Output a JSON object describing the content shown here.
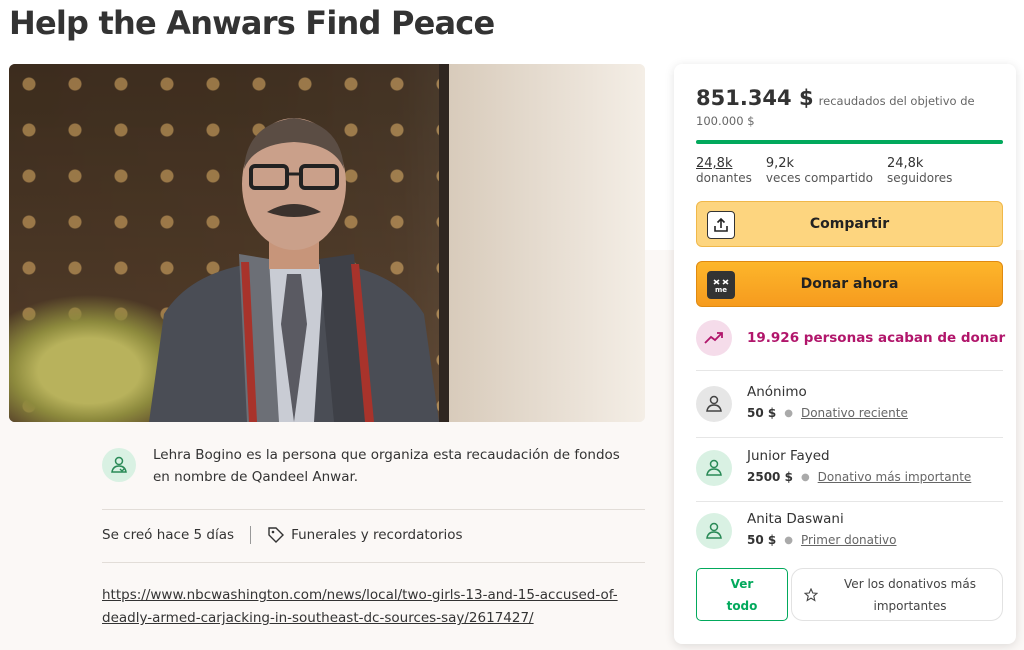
{
  "page": {
    "title": "Help the Anwars Find Peace"
  },
  "organizer": {
    "text": "Lehra Bogino es la persona que organiza esta recaudación de fondos en nombre de Qandeel Anwar.",
    "created": "Se creó hace 5 días",
    "category": "Funerales y recordatorios",
    "link": "https://www.nbcwashington.com/news/local/two-girls-13-and-15-accused-of-deadly-armed-carjacking-in-southeast-dc-sources-say/2617427/"
  },
  "panel": {
    "raised": "851.344 $",
    "goal_text": "recaudados del objetivo de 100.000 $",
    "progress_fraction": 1.0,
    "progress_color": "#02a95c",
    "stats": [
      {
        "num": "24,8k",
        "label": "donantes"
      },
      {
        "num": "9,2k",
        "label": "veces compartido"
      },
      {
        "num": "24,8k",
        "label": "seguidores"
      }
    ],
    "share_label": "Compartir",
    "donate_label": "Donar ahora",
    "recent_text": "19.926 personas acaban de donar",
    "donors": [
      {
        "name": "Anónimo",
        "amount": "50 $",
        "tag": "Donativo reciente"
      },
      {
        "name": "Junior Fayed",
        "amount": "2500 $",
        "tag": "Donativo más importante"
      },
      {
        "name": "Anita Daswani",
        "amount": "50 $",
        "tag": "Primer donativo"
      }
    ],
    "see_all_label": "Ver todo",
    "see_top_label": "Ver los donativos más importantes"
  },
  "icons": {
    "share": "share-upload-icon",
    "donate": "gofundme-me-icon",
    "trend": "trending-up-icon",
    "donor": "donor-heart-hand-icon",
    "tag": "tag-icon",
    "star": "star-icon"
  }
}
